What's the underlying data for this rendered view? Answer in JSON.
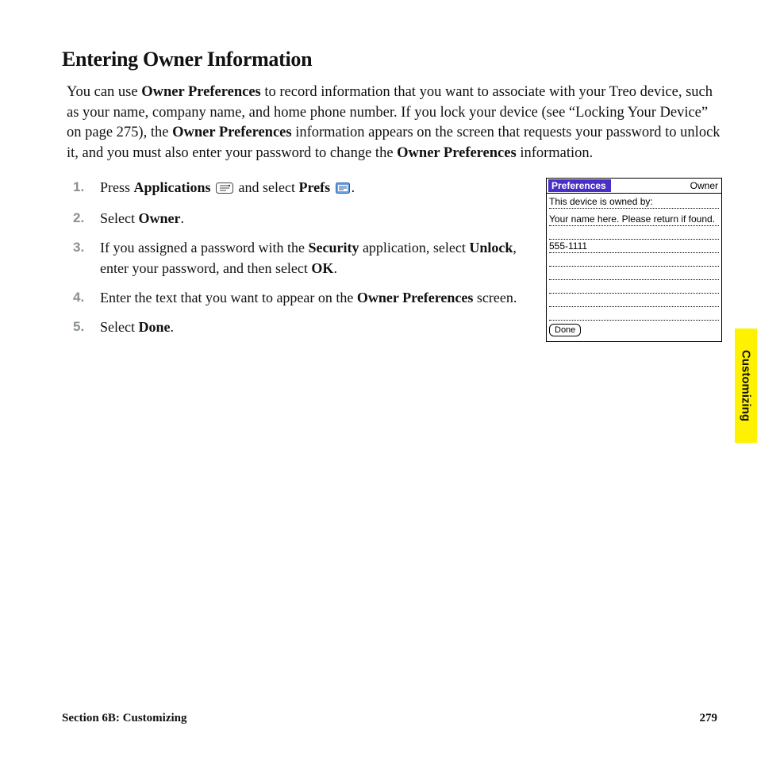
{
  "title": "Entering Owner Information",
  "intro": {
    "t1": "You can use ",
    "b1": "Owner Preferences",
    "t2": " to record information that you want to associate with your Treo device, such as your name, company name, and home phone number. If you lock your device (see “Locking Your Device” on page 275), the ",
    "b2": "Owner Preferences",
    "t3": " information appears on the screen that requests your password to unlock it, and you must also enter your password to change the ",
    "b3": "Owner Preferences",
    "t4": " information."
  },
  "steps": {
    "s1a": "Press ",
    "s1b": "Applications",
    "s1c": " and select ",
    "s1d": "Prefs",
    "s1e": ".",
    "s2a": "Select ",
    "s2b": "Owner",
    "s2c": ".",
    "s3a": "If you assigned a password with the ",
    "s3b": "Security",
    "s3c": " application, select ",
    "s3d": "Unlock",
    "s3e": ", enter your password, and then select ",
    "s3f": "OK",
    "s3g": ".",
    "s4a": "Enter the text that you want to appear on the ",
    "s4b": "Owner Preferences",
    "s4c": " screen.",
    "s5a": "Select ",
    "s5b": "Done",
    "s5c": "."
  },
  "palm": {
    "title": "Preferences",
    "category": "Owner",
    "label": "This device is owned by:",
    "line1": "Your name here.  Please return if found.",
    "line2": "555-1111",
    "done": "Done"
  },
  "side_tab": "Customizing",
  "footer": {
    "section": "Section 6B: Customizing",
    "page": "279"
  }
}
